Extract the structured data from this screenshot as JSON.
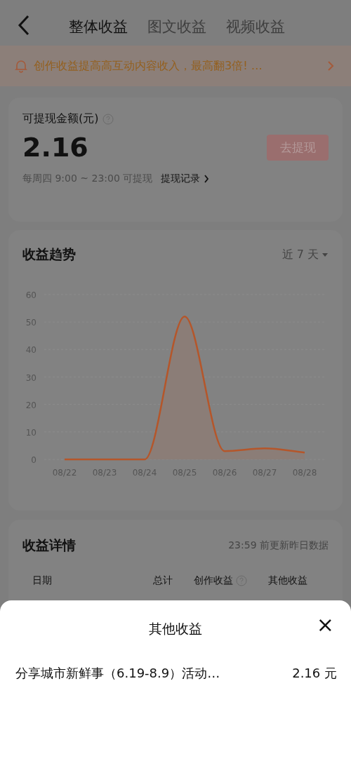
{
  "nav": {
    "tabs": [
      {
        "label": "整体收益",
        "selected": true
      },
      {
        "label": "图文收益",
        "selected": false
      },
      {
        "label": "视频收益",
        "selected": false
      }
    ]
  },
  "banner": {
    "text": "创作收益提高高互动内容收入，最高翻3倍! …"
  },
  "balance": {
    "label": "可提现金额(元)",
    "amount": "2.16",
    "button": "去提现",
    "button_disabled": true,
    "schedule": "每周四 9:00 ~ 23:00 可提现",
    "record_link": "提现记录"
  },
  "trend": {
    "title": "收益趋势",
    "range": "近 7 天",
    "chart_data": {
      "type": "area",
      "categories": [
        "08/22",
        "08/23",
        "08/24",
        "08/25",
        "08/26",
        "08/27",
        "08/28"
      ],
      "series": [
        {
          "color": "#b5562a",
          "values": [
            0,
            0,
            0,
            52,
            3,
            4,
            2.5
          ]
        }
      ],
      "grid": true,
      "ylim": [
        0,
        60
      ],
      "yticks": [
        0,
        10,
        20,
        30,
        40,
        50,
        60
      ]
    }
  },
  "details": {
    "title": "收益详情",
    "note": "23:59 前更新昨日数据",
    "columns": [
      "日期",
      "总计",
      "创作收益",
      "其他收益"
    ]
  },
  "sheet": {
    "title": "其他收益",
    "close": "×",
    "items": [
      {
        "name": "分享城市新鲜事（6.19-8.9）活动…",
        "amount": "2.16 元"
      }
    ]
  }
}
